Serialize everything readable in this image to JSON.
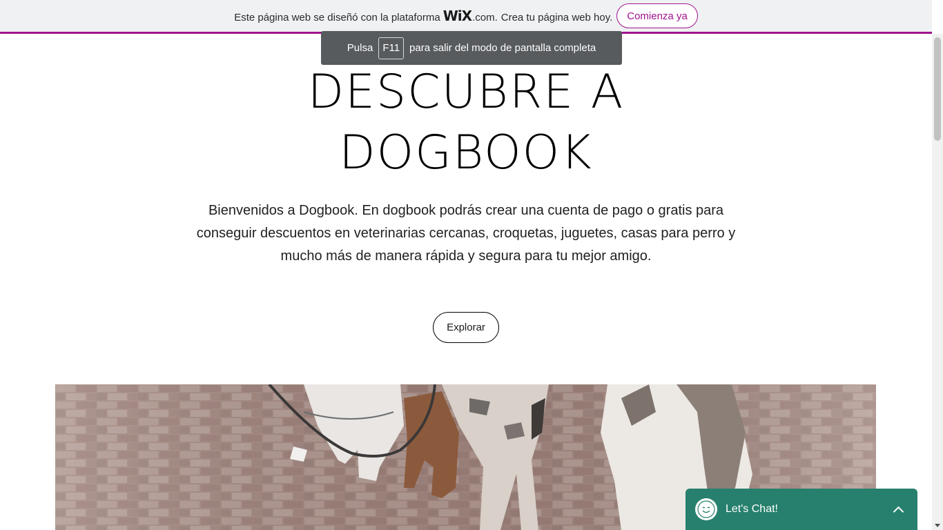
{
  "wix_banner": {
    "message_before": "Este página web se diseñó con la plataforma",
    "logo_text": "WiX",
    "domain_text": ".com.",
    "message_after": "Crea tu página web hoy.",
    "cta_label": "Comienza ya",
    "accent_color": "#a0138e"
  },
  "fullscreen_toast": {
    "prefix": "Pulsa",
    "key": "F11",
    "suffix": "para salir del modo de pantalla completa"
  },
  "hero": {
    "title_line1": "DESCUBRE A",
    "title_line2": "DOGBOOK",
    "description": "Bienvenidos a Dogbook. En dogbook podrás crear una cuenta de pago o gratis para conseguir descuentos en veterinarias cercanas, croquetas, juguetes, casas para perro y mucho más de manera rápida y segura para tu mejor amigo.",
    "explore_label": "Explorar"
  },
  "chat": {
    "label": "Let's Chat!",
    "avatar_icon": "smiley-icon",
    "toggle_icon": "chevron-up-icon",
    "color": "#27806d"
  }
}
